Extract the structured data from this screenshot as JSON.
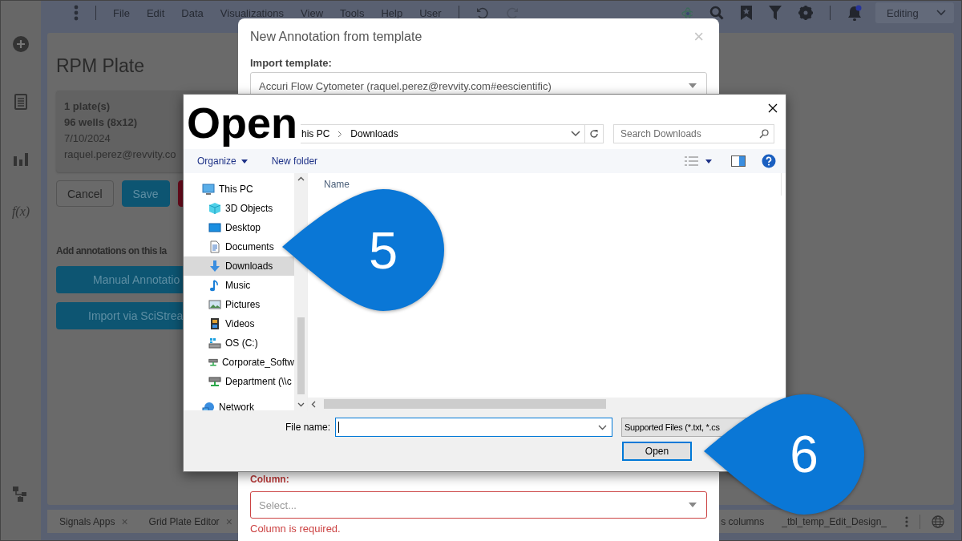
{
  "app": {
    "menu": [
      "File",
      "Edit",
      "Data",
      "Visualizations",
      "View",
      "Tools",
      "Help",
      "User"
    ],
    "mode": "Editing",
    "rail_formula": "f(x)",
    "page_title": "RPM Plate",
    "plate_info": [
      "1 plate(s)",
      "96 wells (8x12)",
      "7/10/2024",
      "raquel.perez@revvity.co"
    ],
    "actions": [
      "Cancel",
      "Save"
    ],
    "annotations_heading": "Add annotations on this la",
    "annotation_buttons": [
      "Manual Annotatio",
      "Import via SciStrea"
    ],
    "bottom_tabs": [
      {
        "label": "Signals Apps",
        "close": "×"
      },
      {
        "label": "Grid Plate Editor",
        "close": "×"
      },
      {
        "label": "s columns"
      },
      {
        "label": "_tbl_temp_Edit_Design_"
      }
    ]
  },
  "template_dialog": {
    "title": "New Annotation from template",
    "close": "×",
    "import_label": "Import template:",
    "template_value": "Accuri Flow Cytometer (raquel.perez@revvity.com#eescientific)",
    "column_label": "Column:",
    "column_placeholder": "Select...",
    "column_error": "Column is required."
  },
  "open_dialog": {
    "path": [
      "his PC",
      "Downloads"
    ],
    "search_placeholder": "Search Downloads",
    "toolbar": [
      "Organize",
      "New folder"
    ],
    "nav": [
      {
        "label": "This PC",
        "selected": false,
        "children": [
          {
            "label": "3D Objects",
            "selected": false
          },
          {
            "label": "Desktop",
            "selected": false
          },
          {
            "label": "Documents",
            "selected": false
          },
          {
            "label": "Downloads",
            "selected": true
          },
          {
            "label": "Music",
            "selected": false
          },
          {
            "label": "Pictures",
            "selected": false
          },
          {
            "label": "Videos",
            "selected": false
          },
          {
            "label": "OS (C:)",
            "selected": false
          },
          {
            "label": "Corporate_Softw",
            "selected": false
          },
          {
            "label": "Department (\\\\c",
            "selected": false
          }
        ]
      },
      {
        "label": "Network",
        "selected": false
      }
    ],
    "column_header": "Name",
    "file_name_label": "File name:",
    "file_type": "Supported Files (*.txt, *.cs",
    "open_button": "Open"
  },
  "annotation_label": "Open",
  "callouts": [
    {
      "number": "5"
    },
    {
      "number": "6"
    }
  ]
}
